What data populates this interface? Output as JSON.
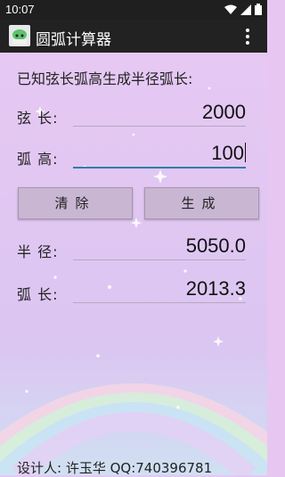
{
  "status_bar": {
    "time": "10:07"
  },
  "app": {
    "title": "圆弧计算器"
  },
  "form": {
    "heading": "已知弦长弧高生成半径弧长:",
    "chord_label": "弦 长:",
    "chord_value": "2000",
    "height_label": "弧 高:",
    "height_value": "100",
    "clear_button": "清除",
    "generate_button": "生成",
    "radius_label": "半 径:",
    "radius_value": "5050.0",
    "arc_label": "弧 长:",
    "arc_value": "2013.3"
  },
  "footer": {
    "text": "设计人: 许玉华 QQ:740396781"
  },
  "colors": {
    "background": "#e7c6f2",
    "appbar": "#222222",
    "accent": "#2f7fa5"
  },
  "icons": [
    "wifi-icon",
    "signal-icon",
    "battery-icon",
    "overflow-menu-icon",
    "app-logo-icon",
    "sparkle-icon",
    "rainbow-decoration"
  ]
}
